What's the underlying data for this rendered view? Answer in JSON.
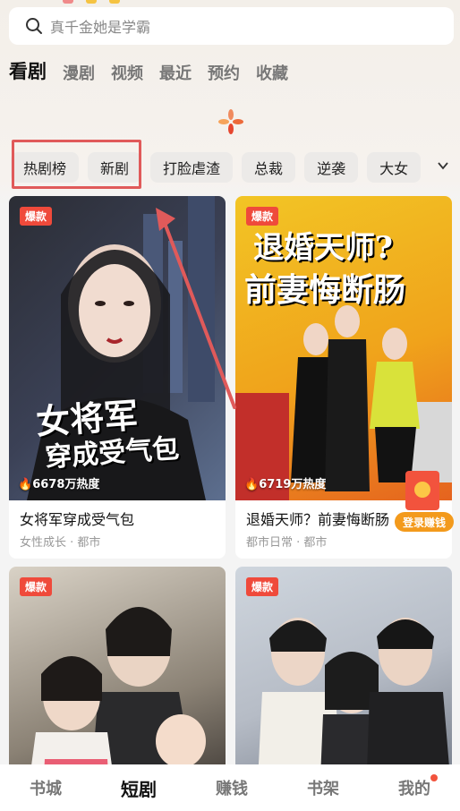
{
  "search": {
    "placeholder": "真千金她是学霸"
  },
  "tabs": [
    {
      "label": "看剧",
      "active": true
    },
    {
      "label": "漫剧"
    },
    {
      "label": "视频"
    },
    {
      "label": "最近"
    },
    {
      "label": "预约"
    },
    {
      "label": "收藏"
    }
  ],
  "chips": [
    "热剧榜",
    "新剧",
    "打脸虐渣",
    "总裁",
    "逆袭",
    "大女"
  ],
  "cards": [
    {
      "badge": "爆款",
      "heat": "6678万热度",
      "title": "女将军穿成受气包",
      "tags": "女性成长 · 都市",
      "poster_title": "女将军穿成受气包"
    },
    {
      "badge": "爆款",
      "heat": "6719万热度",
      "title": "退婚天师？前妻悔断肠",
      "tags": "都市日常 · 都市",
      "poster_title": "退婚天师？前妻悔断肠"
    },
    {
      "badge": "爆款"
    },
    {
      "badge": "爆款"
    }
  ],
  "float_reward": {
    "label": "登录赚钱"
  },
  "bottom_nav": [
    {
      "label": "书城"
    },
    {
      "label": "短剧",
      "active": true
    },
    {
      "label": "赚钱"
    },
    {
      "label": "书架"
    },
    {
      "label": "我的",
      "dot": true
    }
  ],
  "colors": {
    "accent_red": "#ef4a3b",
    "annotation_red": "#e05a5a",
    "reward_orange": "#f39a1c"
  }
}
